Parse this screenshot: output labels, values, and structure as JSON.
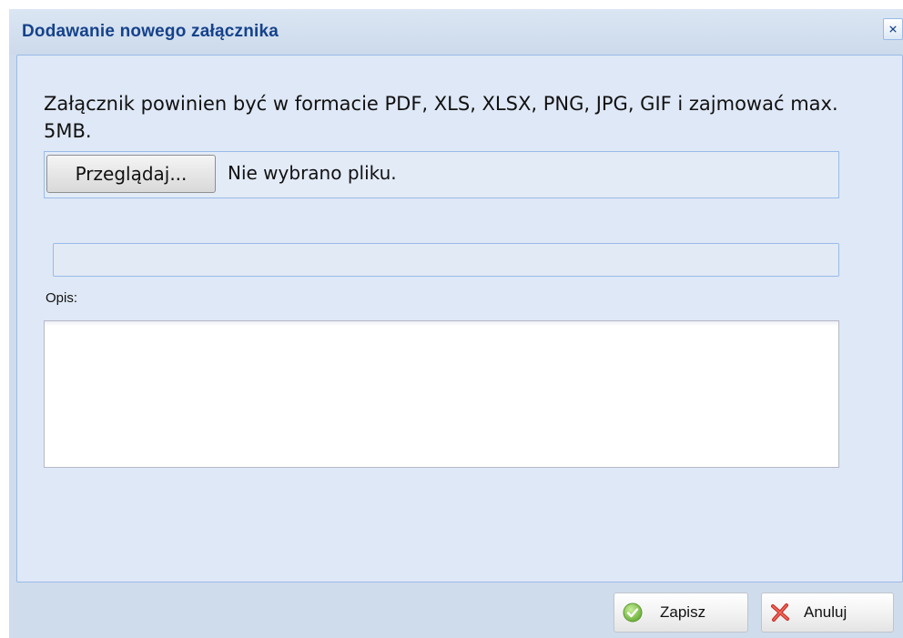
{
  "dialog": {
    "title": "Dodawanie nowego załącznika"
  },
  "form": {
    "info": "Załącznik powinien być w formacie PDF, XLS, XLSX, PNG, JPG, GIF i zajmować max. 5MB.",
    "browse_label": "Przeglądaj...",
    "no_file_label": "Nie wybrano pliku.",
    "upload_progress": 0,
    "description_label": "Opis:",
    "description_value": ""
  },
  "buttons": {
    "save_label": "Zapisz",
    "cancel_label": "Anuluj"
  },
  "icons": {
    "close": "close-icon",
    "save": "check-circle-icon",
    "cancel": "red-x-icon"
  },
  "colors": {
    "title": "#15428b",
    "dialog_background": "#cfdcec",
    "panel_background": "#dfe8f6",
    "panel_border": "#99bbe8",
    "save_icon": "#7fc34b",
    "cancel_icon": "#d83a34"
  }
}
